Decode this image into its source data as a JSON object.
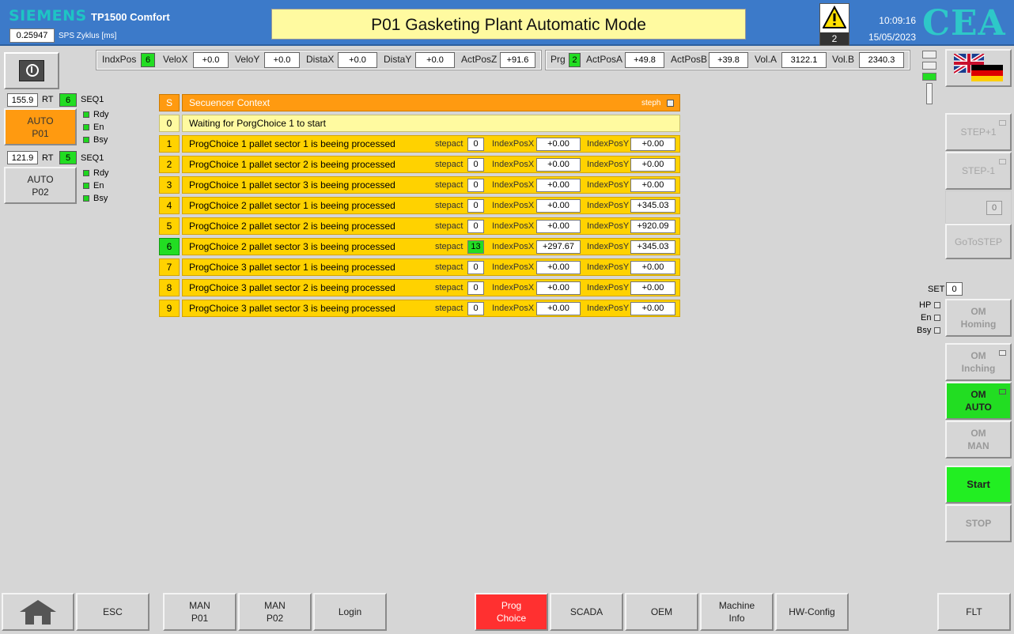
{
  "header": {
    "brand": "SIEMENS",
    "model": "TP1500 Comfort",
    "cycle_value": "0.25947",
    "cycle_label": "SPS Zyklus [ms]",
    "title": "P01 Gasketing Plant Automatic Mode",
    "alarm_count": "2",
    "time": "10:09:16",
    "date": "15/05/2023",
    "logo": "CEA"
  },
  "strip1": {
    "indxpos_label": "IndxPos",
    "indxpos": "6",
    "velox_label": "VeloX",
    "velox": "+0.0",
    "veloy_label": "VeloY",
    "veloy": "+0.0",
    "distax_label": "DistaX",
    "distax": "+0.0",
    "distay_label": "DistaY",
    "distay": "+0.0",
    "actposz_label": "ActPosZ",
    "actposz": "+91.6"
  },
  "strip2": {
    "prg_label": "Prg",
    "prg": "2",
    "actposa_label": "ActPosA",
    "actposa": "+49.8",
    "actposb_label": "ActPosB",
    "actposb": "+39.8",
    "vola_label": "Vol.A",
    "vola": "3122.1",
    "volb_label": "Vol.B",
    "volb": "2340.3"
  },
  "left": {
    "p1": {
      "rt_value": "155.9",
      "rt_label": "RT",
      "seq_num": "6",
      "seq_label": "SEQ1",
      "btn_line1": "AUTO",
      "btn_line2": "P01",
      "rdy": "Rdy",
      "en": "En",
      "bsy": "Bsy"
    },
    "p2": {
      "rt_value": "121.9",
      "rt_label": "RT",
      "seq_num": "5",
      "seq_label": "SEQ1",
      "btn_line1": "AUTO",
      "btn_line2": "P02",
      "rdy": "Rdy",
      "en": "En",
      "bsy": "Bsy"
    }
  },
  "seq": {
    "header_s": "S",
    "header_title": "Secuencer Context",
    "header_flag": "steph",
    "row0_num": "0",
    "row0_text": "Waiting for PorgChoice 1 to start",
    "lbl_stepact": "stepact",
    "lbl_ix": "IndexPosX",
    "lbl_iy": "IndexPosY",
    "rows": [
      {
        "n": "1",
        "t": "ProgChoice 1 pallet sector 1 is beeing processed",
        "s": "0",
        "x": "+0.00",
        "y": "+0.00",
        "active": false
      },
      {
        "n": "2",
        "t": "ProgChoice 1 pallet sector 2 is beeing processed",
        "s": "0",
        "x": "+0.00",
        "y": "+0.00",
        "active": false
      },
      {
        "n": "3",
        "t": "ProgChoice 1 pallet sector 3 is beeing processed",
        "s": "0",
        "x": "+0.00",
        "y": "+0.00",
        "active": false
      },
      {
        "n": "4",
        "t": "ProgChoice 2 pallet sector 1 is beeing processed",
        "s": "0",
        "x": "+0.00",
        "y": "+345.03",
        "active": false
      },
      {
        "n": "5",
        "t": "ProgChoice 2 pallet sector 2 is beeing processed",
        "s": "0",
        "x": "+0.00",
        "y": "+920.09",
        "active": false
      },
      {
        "n": "6",
        "t": "ProgChoice 2 pallet sector 3 is beeing processed",
        "s": "13",
        "x": "+297.67",
        "y": "+345.03",
        "active": true
      },
      {
        "n": "7",
        "t": "ProgChoice 3 pallet sector 1 is beeing processed",
        "s": "0",
        "x": "+0.00",
        "y": "+0.00",
        "active": false
      },
      {
        "n": "8",
        "t": "ProgChoice 3 pallet sector 2 is beeing processed",
        "s": "0",
        "x": "+0.00",
        "y": "+0.00",
        "active": false
      },
      {
        "n": "9",
        "t": "ProgChoice 3 pallet sector 3 is beeing processed",
        "s": "0",
        "x": "+0.00",
        "y": "+0.00",
        "active": false
      }
    ]
  },
  "right": {
    "step_plus": "STEP+1",
    "step_minus": "STEP-1",
    "goto_value": "0",
    "goto_label": "GoToSTEP",
    "set_label": "SET",
    "set_value": "0",
    "hp": "HP",
    "en": "En",
    "bsy": "Bsy",
    "om_homing": "OM Homing",
    "om_inching": "OM Inching",
    "om_auto": "OM AUTO",
    "om_man": "OM MAN",
    "start": "Start",
    "stop": "STOP"
  },
  "bottom": {
    "esc": "ESC",
    "man_p01_1": "MAN",
    "man_p01_2": "P01",
    "man_p02_1": "MAN",
    "man_p02_2": "P02",
    "login": "Login",
    "prog_1": "Prog",
    "prog_2": "Choice",
    "scada": "SCADA",
    "oem": "OEM",
    "machine_1": "Machine",
    "machine_2": "Info",
    "hwconfig": "HW-Config",
    "flt": "FLT"
  },
  "colors": {
    "header": "#3c7ac9",
    "active_green": "#22dd22",
    "orange": "#ff9a10",
    "yellow": "#ffd200",
    "red": "#ff3030"
  }
}
